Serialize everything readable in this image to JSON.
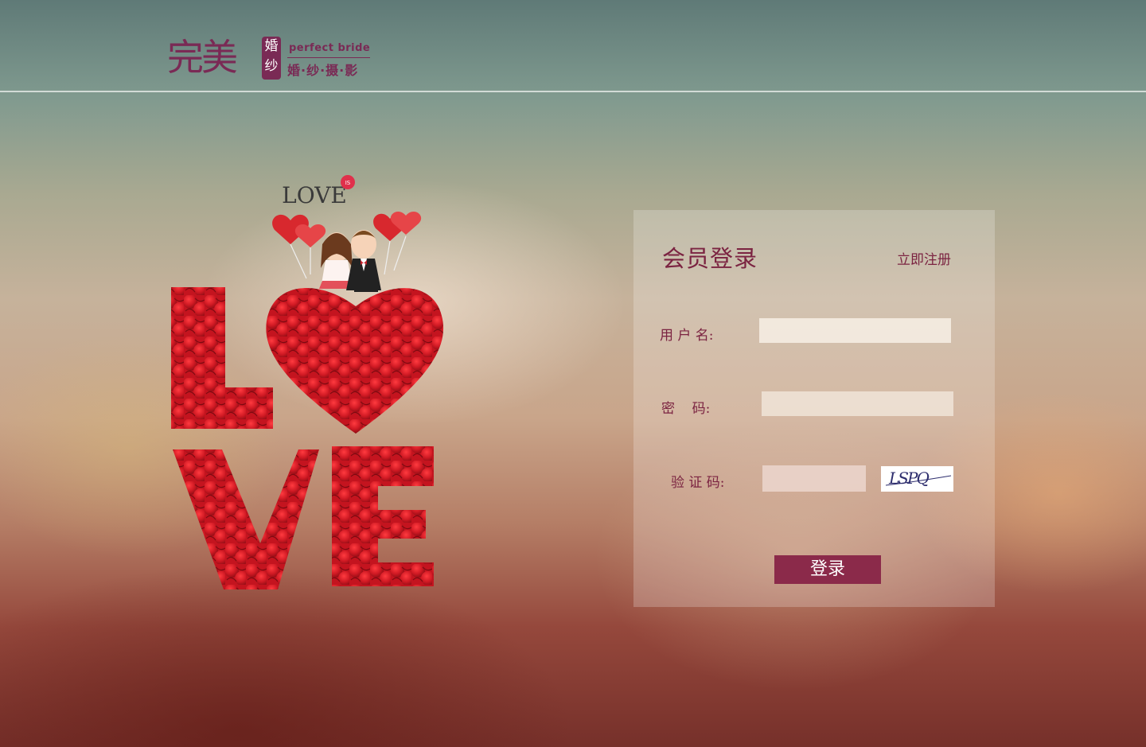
{
  "brand": {
    "name_big": "完美",
    "badge_top": "婚",
    "badge_bottom": "纱",
    "name_en": "perfect bride",
    "tagline": "婚·纱·摄·影",
    "color": "#7a2a55"
  },
  "hero": {
    "small_love": "LOVE",
    "is_badge": "IS",
    "petal_color": "#d11a24"
  },
  "login": {
    "title": "会员登录",
    "register_link": "立即注册",
    "username_label": "用 户 名:",
    "username_value": "",
    "password_label": "密    码:",
    "password_value": "",
    "captcha_label": "验 证 码:",
    "captcha_value": "",
    "captcha_text": "LSPQ",
    "submit_label": "登录",
    "accent_color": "#8b2a4a"
  }
}
